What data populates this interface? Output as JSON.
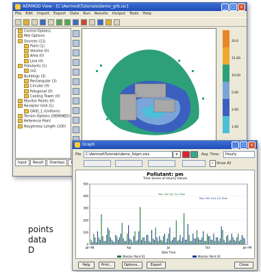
{
  "main_window": {
    "title": "AERMOD View - [C:\\Aermod\\Tutorials\\demo_grb.isc]",
    "menu": [
      "File",
      "Edit",
      "Import",
      "Export",
      "Data",
      "Run",
      "Results",
      "Output",
      "Tools",
      "Help"
    ],
    "tree_items": [
      "Control Options",
      "Met Options",
      "Sources (11)",
      "Point (1)",
      "Volume (0)",
      "Area (0)",
      "Line (0)",
      "Pollutants (1)",
      "so2",
      "Buildings (3)",
      "Rectangular (3)",
      "Circular (0)",
      "Polygonal (0)",
      "Cooling Tower (0)",
      "Monitor Points (0)",
      "Receptor Grid (1)",
      "GRID_1 (Uniform)",
      "Terrain Options (DEM/NED)",
      "Reference Point",
      "Roughness Length (100)"
    ],
    "bottom_tabs": [
      "Input",
      "Result",
      "Overlays",
      "Labels"
    ],
    "colorbar_labels": [
      "20.0",
      "15.00",
      "10.00",
      "5.00",
      "2.00",
      "1.00"
    ],
    "colorbar_colors": [
      "#e8862a",
      "#f0a830",
      "#2da07a",
      "#7aa5d8",
      "#3b5fbf",
      "#4bc0d8"
    ]
  },
  "graph_window": {
    "title": "Graph",
    "file_label": "File",
    "file_value": "C:\\Aermod\\Tutorials\\demo_5dgm.xlsx",
    "avg_time_label": "Avg. Time:",
    "avg_time_value": "Hourly",
    "show_all_label": "Show All",
    "chart_title": "Pollutant: pm",
    "chart_subtitle": "Time Series of Hourly Values",
    "x_ticks": [
      "Jan-98",
      "Apr",
      "Jul",
      "Oct",
      "Jan-99"
    ],
    "y_ticks": [
      "500",
      "400",
      "300",
      "200",
      "100",
      "0"
    ],
    "x_axis_label": "Date Time",
    "legend": [
      "Monitor Point 01",
      "Monitor Point 02"
    ],
    "buttons": [
      "Help",
      "Print...",
      "Options...",
      "Export",
      "Close"
    ]
  },
  "caption": {
    "line1": "points",
    "line2": "data",
    "line3": "D"
  },
  "chart_data": {
    "type": "line",
    "title": "Pollutant: pm",
    "subtitle": "Time Series of Hourly Values",
    "xlabel": "Date Time",
    "x_categories": [
      "Jan-98",
      "Apr",
      "Jul",
      "Oct",
      "Jan-99"
    ],
    "ylim": [
      0,
      500
    ],
    "series": [
      {
        "name": "Monitor Point 01",
        "color": "#1a7a3a",
        "values": [
          40,
          90,
          20,
          60,
          250,
          30,
          80,
          120,
          40,
          20,
          70,
          60,
          180,
          30,
          90,
          50,
          20,
          110,
          40,
          310,
          60,
          30,
          80,
          20,
          50,
          140,
          30,
          40,
          70,
          20,
          90,
          30,
          60,
          200,
          40,
          30,
          260,
          40,
          80,
          30,
          50,
          120,
          40,
          60,
          30,
          90,
          70,
          40,
          30,
          60,
          50,
          120,
          20,
          80,
          40,
          60,
          30,
          90,
          40,
          60
        ]
      },
      {
        "name": "Monitor Point 02",
        "color": "#1f3a8f",
        "values": [
          20,
          60,
          110,
          40,
          70,
          30,
          140,
          60,
          30,
          80,
          40,
          90,
          50,
          30,
          160,
          40,
          70,
          30,
          110,
          40,
          60,
          80,
          30,
          120,
          40,
          60,
          70,
          30,
          90,
          50,
          140,
          40,
          60,
          30,
          80,
          60,
          40,
          170,
          30,
          90,
          50,
          60,
          40,
          110,
          30,
          70,
          40,
          90,
          60,
          30,
          150,
          40,
          70,
          30,
          90,
          40,
          60,
          30,
          80,
          50
        ]
      }
    ],
    "annotations": [
      "Max 500 (Jul-31) Peak",
      "Max 300 (Oct-12) Peak"
    ]
  }
}
